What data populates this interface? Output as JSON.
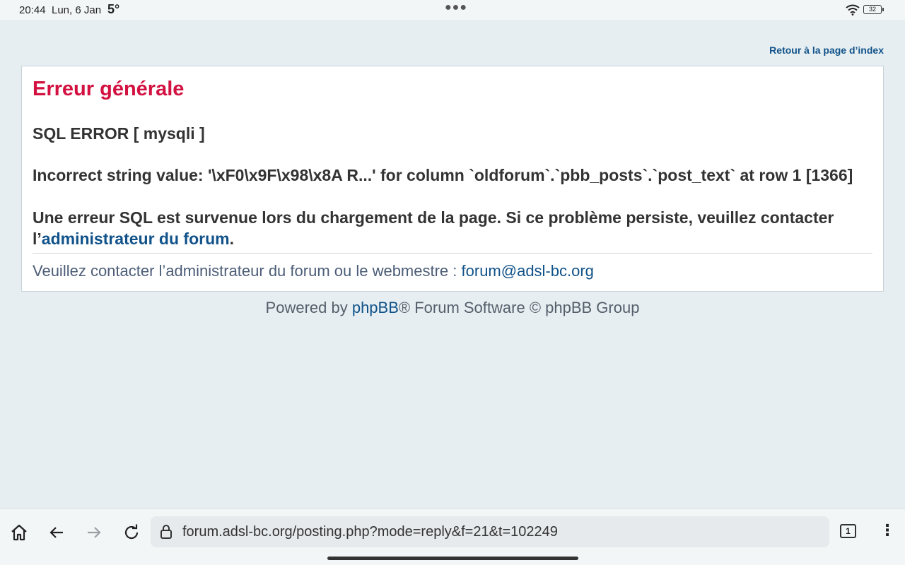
{
  "status_bar": {
    "time": "20:44",
    "date": "Lun, 6 Jan",
    "temperature": "5°",
    "battery": "32"
  },
  "header": {
    "index_link": "Retour à la page d’index"
  },
  "error": {
    "title": "Erreur générale",
    "sql_title": "SQL ERROR [ mysqli ]",
    "sql_message": "Incorrect string value: '\\xF0\\x9F\\x98\\x8A R...' for column `oldforum`.`pbb_posts`.`post_text` at row 1 [1366]",
    "info_prefix": "Une erreur SQL est survenue lors du chargement de la page. Si ce problème persiste, veuillez contacter l’",
    "info_link": "administrateur du forum",
    "info_suffix": ".",
    "contact_text": "Veuillez contacter l’administrateur du forum ou le webmestre : ",
    "contact_email": "forum@adsl-bc.org"
  },
  "footer": {
    "powered_prefix": "Powered by ",
    "powered_link": "phpBB",
    "powered_suffix": "® Forum Software © phpBB Group"
  },
  "browser": {
    "url": "forum.adsl-bc.org/posting.php?mode=reply&f=21&t=102249",
    "tab_count": "1"
  },
  "colors": {
    "title": "#d31141",
    "link": "#105289",
    "background": "#e6eef1"
  }
}
